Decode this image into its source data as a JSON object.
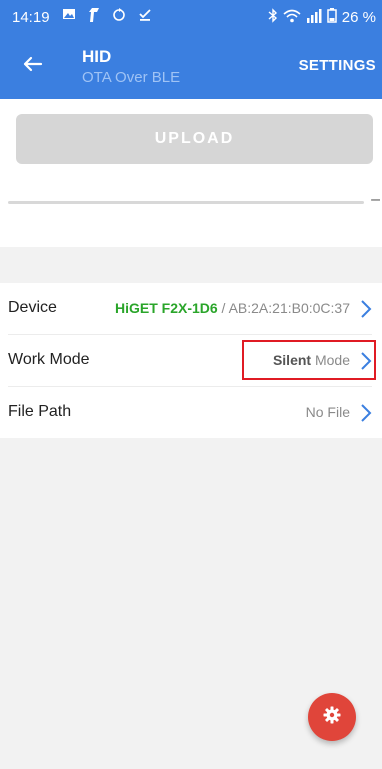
{
  "status_bar": {
    "time": "14:19",
    "battery_text": "26 %"
  },
  "app_bar": {
    "title": "HID",
    "subtitle": "OTA Over BLE",
    "settings_label": "SETTINGS"
  },
  "upload": {
    "label": "UPLOAD"
  },
  "progress": {
    "fraction": 0,
    "text": "–"
  },
  "list": {
    "device": {
      "label": "Device",
      "name": "HiGET F2X-1D6",
      "separator": " / ",
      "mac": "AB:2A:21:B0:0C:37"
    },
    "work_mode": {
      "label": "Work Mode",
      "mode_strong": "Silent",
      "mode_light": " Mode"
    },
    "file_path": {
      "label": "File Path",
      "value": "No File"
    }
  },
  "colors": {
    "primary": "#3b7fe0",
    "fab": "#e0453a",
    "device_name": "#2aa52a",
    "highlight_box": "#e01b24"
  },
  "icons": {
    "back": "arrow-left",
    "chevron": "chevron-right",
    "fab": "gear"
  }
}
